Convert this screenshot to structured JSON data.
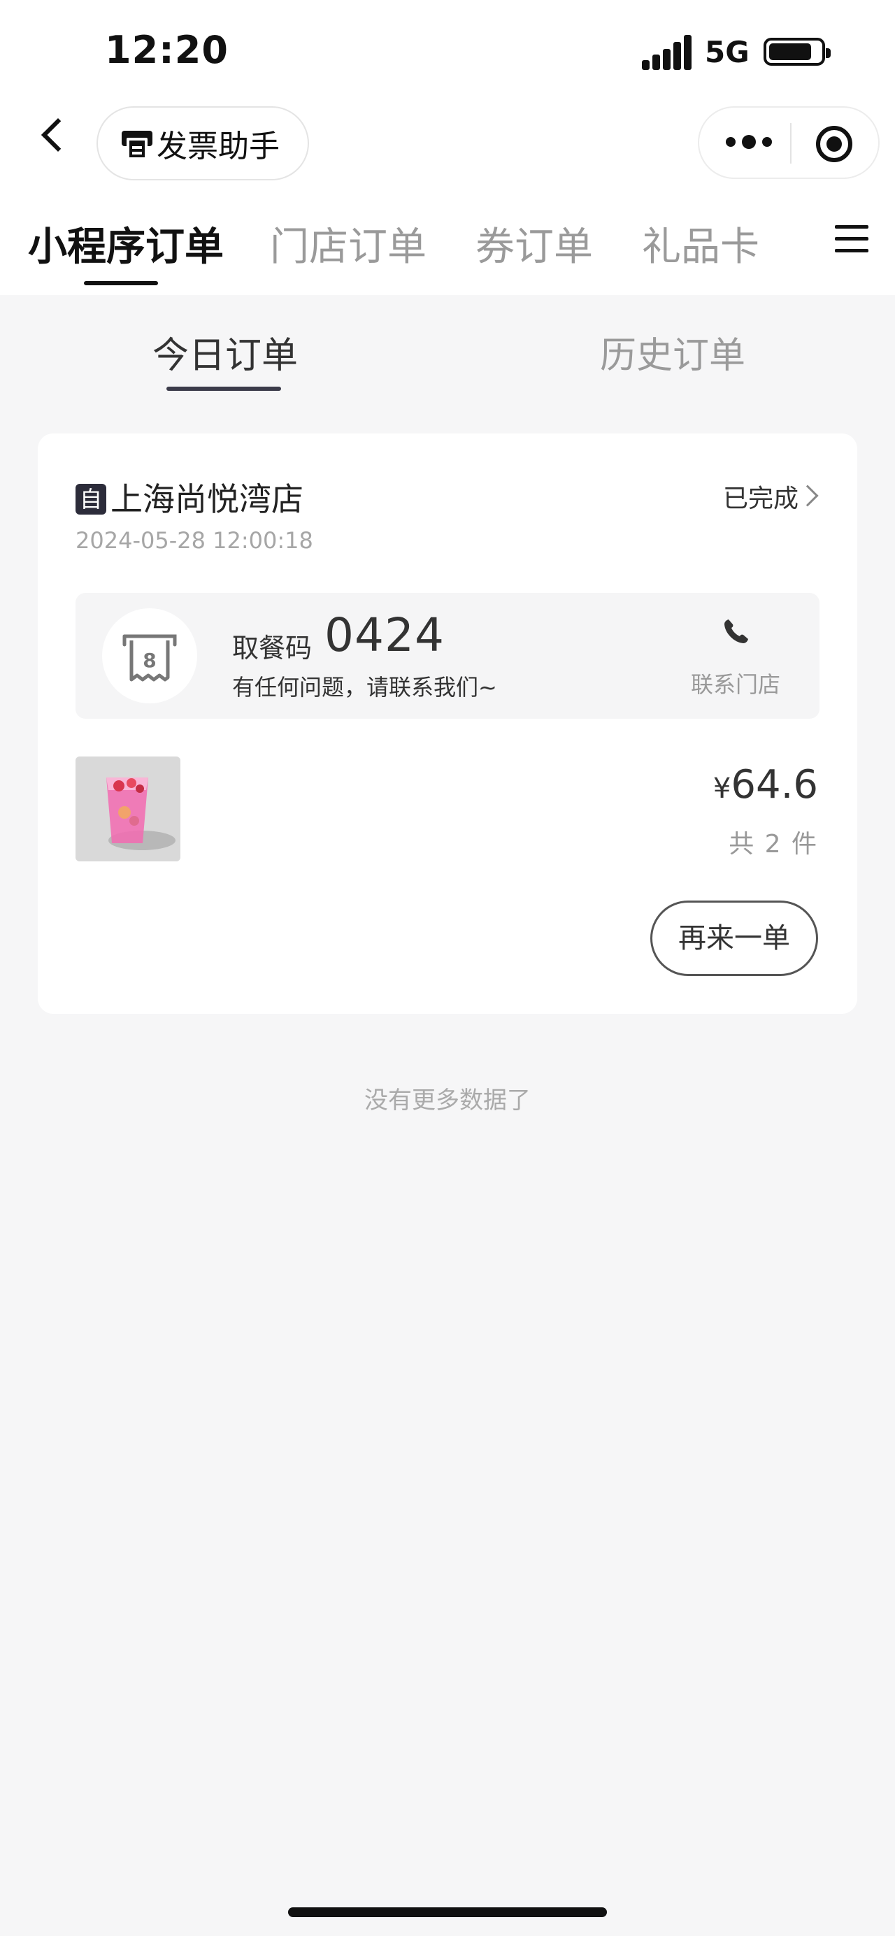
{
  "status_bar": {
    "time": "12:20",
    "network": "5G"
  },
  "nav": {
    "invoice_label": "发票助手"
  },
  "main_tabs": [
    {
      "label": "小程序订单",
      "active": true
    },
    {
      "label": "门店订单",
      "active": false
    },
    {
      "label": "券订单",
      "active": false
    },
    {
      "label": "礼品卡",
      "active": false
    }
  ],
  "sub_tabs": [
    {
      "label": "今日订单",
      "active": true
    },
    {
      "label": "历史订单",
      "active": false
    }
  ],
  "order": {
    "type_badge": "自",
    "store_name": "上海尚悦湾店",
    "status": "已完成",
    "datetime": "2024-05-28 12:00:18",
    "pickup_label": "取餐码",
    "pickup_code": "0424",
    "contact_hint": "有任何问题，请联系我们~",
    "contact_store_label": "联系门店",
    "receipt_number": "8",
    "currency": "¥",
    "price": "64.6",
    "item_count": "共 2 件",
    "reorder_label": "再来一单"
  },
  "footer": {
    "no_more": "没有更多数据了"
  },
  "colors": {
    "accent_dark": "#2c2c3a",
    "background": "#f6f6f7",
    "muted": "#9a9a9a"
  }
}
